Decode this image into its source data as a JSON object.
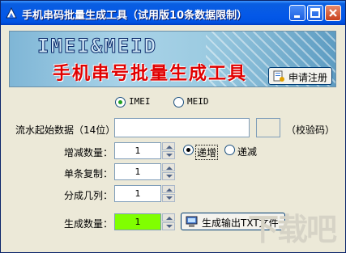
{
  "window": {
    "title": "手机串码批量生成工具（试用版10条数据限制）"
  },
  "banner": {
    "line1": "IMEI&MEID",
    "line2": "手机串号批量生成工具"
  },
  "register_button": {
    "label": "申请注册"
  },
  "type_options": [
    {
      "label": "IMEI",
      "selected": true
    },
    {
      "label": "MEID",
      "selected": false
    }
  ],
  "form": {
    "start_label": "流水起始数据（14位）:",
    "start_value": "",
    "checkcode_value": "",
    "checkcode_label": "（校验码）",
    "step_label": "增减数量：",
    "step_value": "1",
    "direction_options": [
      {
        "label": "递增",
        "selected": true
      },
      {
        "label": "递减",
        "selected": false
      }
    ],
    "copies_label": "单条复制：",
    "copies_value": "1",
    "columns_label": "分成几列：",
    "columns_value": "1",
    "count_label": "生成数量：",
    "count_value": "1",
    "count_bg": "#80ff00"
  },
  "generate_button": {
    "label": "生成输出TXT文件"
  },
  "watermark": "下载吧",
  "colors": {
    "title_bar": "#0054e3",
    "banner_red": "#e00000",
    "radio_dot": "#21a121"
  }
}
